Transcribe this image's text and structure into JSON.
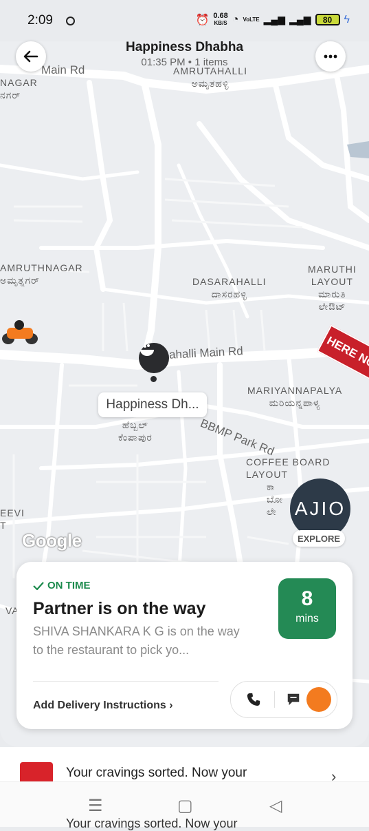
{
  "status_bar": {
    "time": "2:09",
    "net_speed": "0.68",
    "net_unit": "KB/S",
    "volte": "VoLTE",
    "battery": "80"
  },
  "header": {
    "title": "Happiness Dhabha",
    "subtitle": "01:35 PM • 1 items"
  },
  "map": {
    "labels": {
      "main_rd_top": "Main Rd",
      "nagar_left": "NAGAR",
      "nagar_left_kn": "ನಗರ್",
      "amrutahalli": "AMRUTAHALLI",
      "amrutahalli_kn": "ಅಮೃತಹಳ್ಳಿ",
      "amruthnagar": "AMRUTHNAGAR",
      "amruthnagar_kn": "ಅಮೃತ್ನಗರ್",
      "dasarahalli": "DASARAHALLI",
      "dasarahalli_kn": "ದಾಸರಹಳ್ಳಿ",
      "maruthi_layout": "MARUTHI",
      "maruthi_layout_2": "LAYOUT",
      "maruthi_kn": "ಮಾರುತಿ",
      "maruthi_kn_2": "ಲೇಔಟ್",
      "main_rd_center": "ahalli Main Rd",
      "mariyannapalya": "MARIYANNAPALYA",
      "mariyannapalya_kn": "ಮರಿಯನ್ನಪಾಳ್ಯ",
      "bbmp_park_rd": "BBMP Park Rd",
      "kempapura_kn": "ಹೆಬ್ಬಲ್",
      "kempapura_kn_2": "ಕೆಂಪಾಪುರ",
      "coffee_board": "COFFEE BOARD",
      "coffee_board_2": "LAYOUT",
      "coffee_board_kn": "ಕಾ",
      "coffee_board_kn_2": "ಬೋ",
      "coffee_board_kn_3": "ಲೇ",
      "eevi_partial": "EEVI",
      "eevi_partial_2": "T",
      "va_partial": "VA"
    },
    "restaurant_chip": "Happiness Dh...",
    "banner": "HERE NO",
    "google": "Google",
    "ajio": {
      "logo": "AJIO",
      "label": "EXPLORE"
    }
  },
  "status_card": {
    "tag": "ON TIME",
    "headline": "Partner is on the way",
    "description": "SHIVA SHANKARA K G is on the way to the restaurant to pick yo...",
    "eta_value": "8",
    "eta_unit": "mins",
    "instructions": "Add Delivery Instructions",
    "colors": {
      "accent": "#248a55",
      "tag": "#1b8a4c"
    }
  },
  "promo": {
    "text": "Your cravings sorted. Now your",
    "ghost_text": "Your cravings sorted. Now your"
  }
}
